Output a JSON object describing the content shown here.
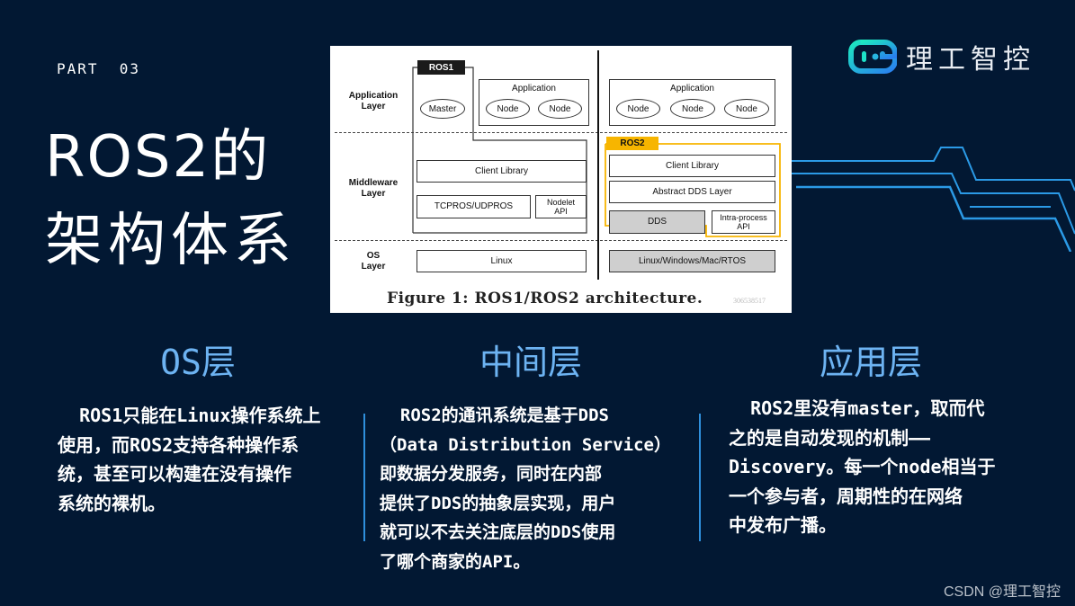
{
  "header": {
    "part_label": "PART  03",
    "title_line1": "ROS2的",
    "title_line2": "架构体系"
  },
  "logo": {
    "icon": "og-logo-icon",
    "text": "理工智控",
    "gradient": [
      "#1de0c6",
      "#2a8cf0"
    ]
  },
  "figure": {
    "caption": "Figure 1: ROS1/ROS2 architecture.",
    "watermark": "306538517",
    "layers": {
      "application": "Application\nLayer",
      "middleware": "Middleware\nLayer",
      "os": "OS\nLayer"
    },
    "ros1": {
      "tag": "ROS1",
      "master": "Master",
      "application_title": "Application",
      "nodes": [
        "Node",
        "Node"
      ],
      "client_library": "Client Library",
      "transport": "TCPROS/UDPROS",
      "nodelet": "Nodelet\nAPI",
      "os": "Linux"
    },
    "ros2": {
      "tag": "ROS2",
      "tag_color": "#f7b500",
      "application_title": "Application",
      "nodes": [
        "Node",
        "Node",
        "Node"
      ],
      "client_library": "Client Library",
      "abstract_dds": "Abstract DDS Layer",
      "dds": "DDS",
      "intra_process": "Intra-process\nAPI",
      "os": "Linux/Windows/Mac/RTOS"
    }
  },
  "columns": [
    {
      "heading": "OS层",
      "lines": [
        "  ROS1只能在Linux操作系统上",
        "使用，而ROS2支持各种操作系",
        "统，甚至可以构建在没有操作",
        "系统的裸机。"
      ]
    },
    {
      "heading": "中间层",
      "lines": [
        "  ROS2的通讯系统是基于DDS",
        "（Data Distribution Service）",
        "即数据分发服务，同时在内部",
        "提供了DDS的抽象层实现，用户",
        "就可以不去关注底层的DDS使用",
        "了哪个商家的API。"
      ]
    },
    {
      "heading": "应用层",
      "lines": [
        "  ROS2里没有master，取而代",
        "之的是自动发现的机制——",
        "Discovery。每一个node相当于",
        "一个参与者，周期性的在网络",
        "中发布广播。"
      ]
    }
  ],
  "colors": {
    "background": "#021833",
    "heading": "#6db3f2",
    "accent_line": "#2f8fdc"
  },
  "watermark": "CSDN @理工智控"
}
